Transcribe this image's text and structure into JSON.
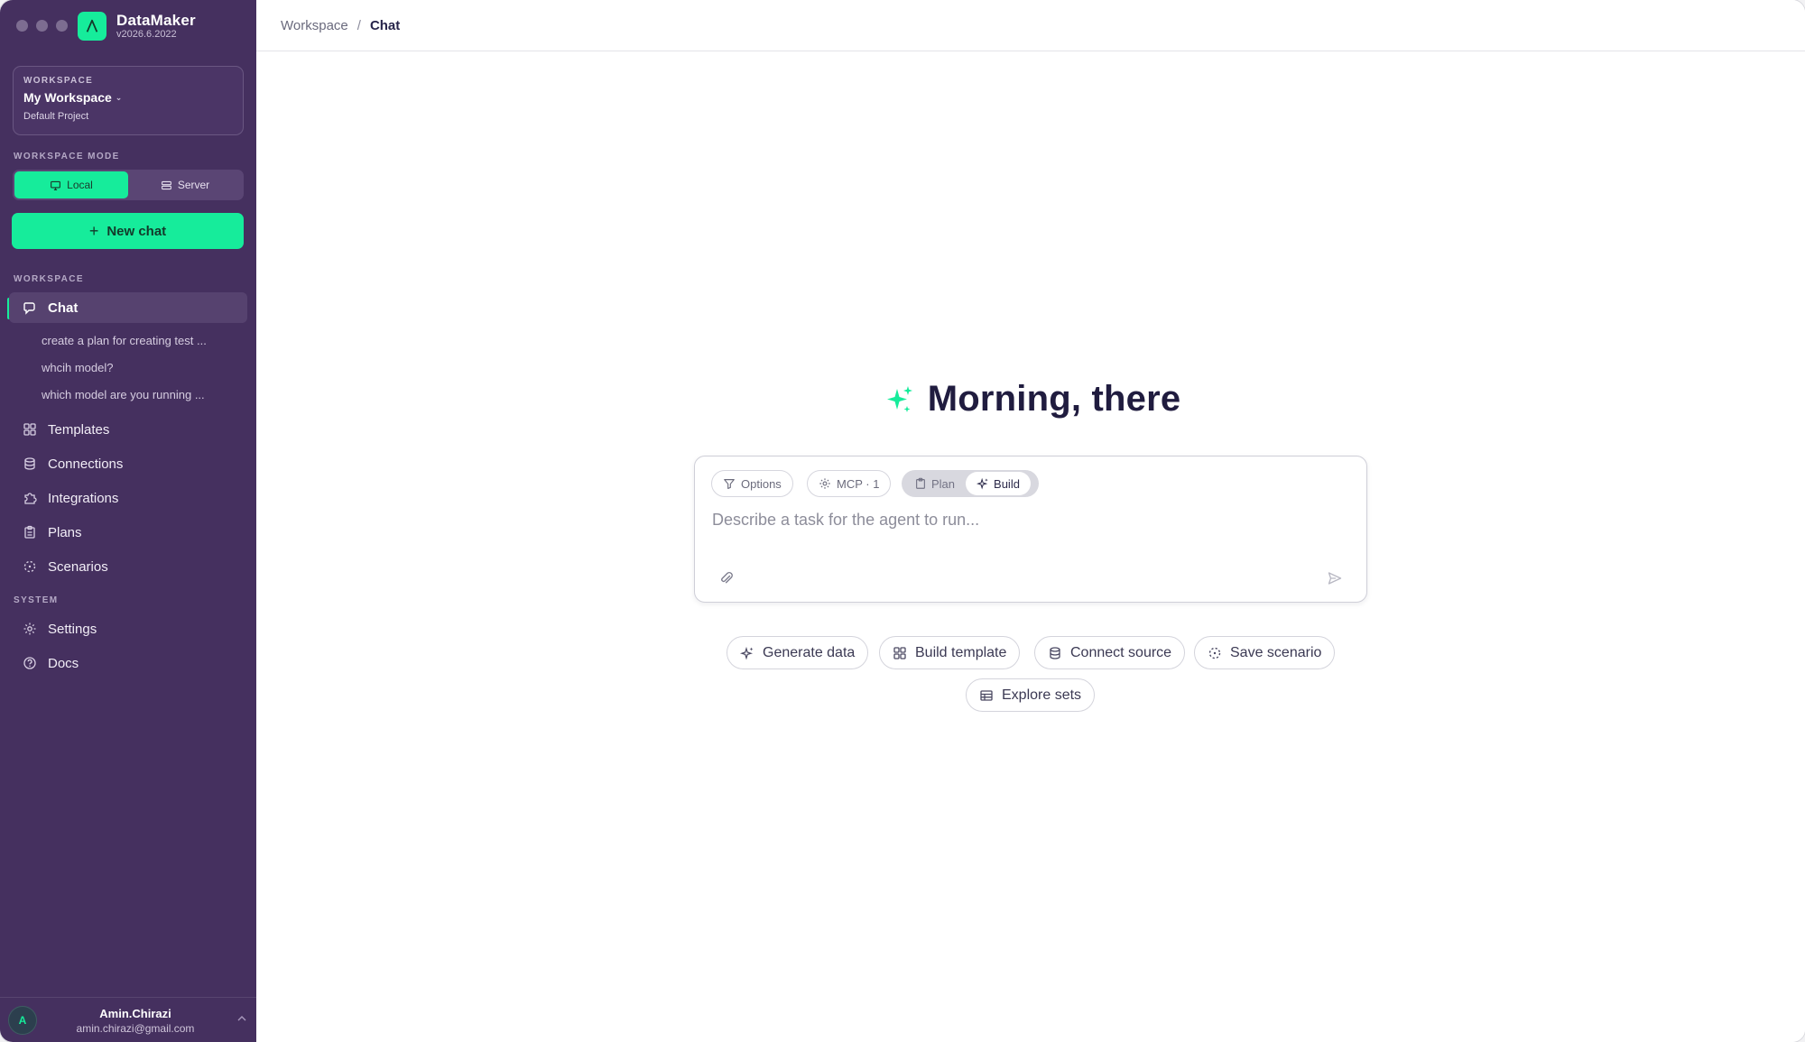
{
  "app": {
    "name": "DataMaker",
    "version": "v2026.6.2022"
  },
  "workspace": {
    "label": "WORKSPACE",
    "name": "My Workspace",
    "project": "Default Project"
  },
  "mode": {
    "label": "WORKSPACE MODE",
    "local": "Local",
    "server": "Server",
    "selected": "Local"
  },
  "new_chat": "New chat",
  "sections": {
    "workspace": "WORKSPACE",
    "system": "SYSTEM"
  },
  "nav": {
    "chat": "Chat",
    "templates": "Templates",
    "connections": "Connections",
    "integrations": "Integrations",
    "plans": "Plans",
    "scenarios": "Scenarios",
    "settings": "Settings",
    "docs": "Docs"
  },
  "recent_chats": [
    "create a plan for creating test ...",
    "whcih model?",
    "which model are you running ..."
  ],
  "user": {
    "initial": "A",
    "name": "Amin.Chirazi",
    "email": "amin.chirazi@gmail.com"
  },
  "breadcrumb": {
    "root": "Workspace",
    "separator": "/",
    "current": "Chat"
  },
  "greeting": "Morning, there",
  "composer": {
    "options": "Options",
    "mcp": "MCP · 1",
    "plan": "Plan",
    "build": "Build",
    "selected_mode": "Build",
    "placeholder": "Describe a task for the agent to run..."
  },
  "suggestions": [
    "Generate data",
    "Build template",
    "Connect source",
    "Save scenario",
    "Explore sets"
  ],
  "colors": {
    "sidebar": "#45305f",
    "accent": "#16ec9b",
    "text": "#201c3f"
  }
}
